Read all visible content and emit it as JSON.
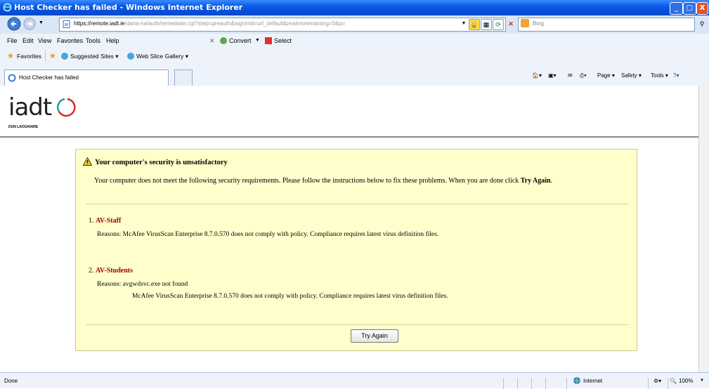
{
  "window": {
    "title": "Host Checker has failed - Windows Internet Explorer",
    "controls": [
      "_",
      "□",
      "X"
    ]
  },
  "address": {
    "prefix": "https://",
    "host": "remote.iadt.ie",
    "path": "/dana-na/auth/remediate.cgi?step=preauth&signinId=url_default&realmsremaining=0&p=",
    "search_placeholder": "Bing"
  },
  "menu": [
    "File",
    "Edit",
    "View",
    "Favorites",
    "Tools",
    "Help"
  ],
  "toolbar": {
    "convert": "Convert",
    "select": "Select"
  },
  "favorites": {
    "label": "Favorites",
    "suggested": "Suggested Sites ▾",
    "webslice": "Web Slice Gallery ▾"
  },
  "tab": {
    "title": "Host Checker has failed"
  },
  "commands": {
    "page": "Page ▾",
    "safety": "Safety ▾",
    "tools": "Tools ▾"
  },
  "logo": {
    "text": "iadt",
    "sub": "DUN LAOGHAIRE"
  },
  "panel": {
    "heading": "Your computer's security is unsatisfactory",
    "intro": "Your computer does not meet the following security requirements. Please follow the instructions below to fix these problems. When you are done click",
    "intro_bold": "Try Again",
    "items": [
      {
        "num": "1.",
        "name": "AV-Staff",
        "reasons": [
          "Reasons: McAfee VirusScan Enterprise 8.7.0.570 does not comply with policy. Compliance requires latest virus definition files."
        ]
      },
      {
        "num": "2.",
        "name": "AV-Students",
        "reasons": [
          "Reasons: avgwdsvc.exe not found",
          "McAfee VirusScan Enterprise 8.7.0.570 does not comply with policy. Compliance requires latest virus definition files."
        ]
      }
    ],
    "button": "Try Again"
  },
  "status": {
    "left": "Done",
    "zone": "Internet",
    "zoom": "100%"
  }
}
